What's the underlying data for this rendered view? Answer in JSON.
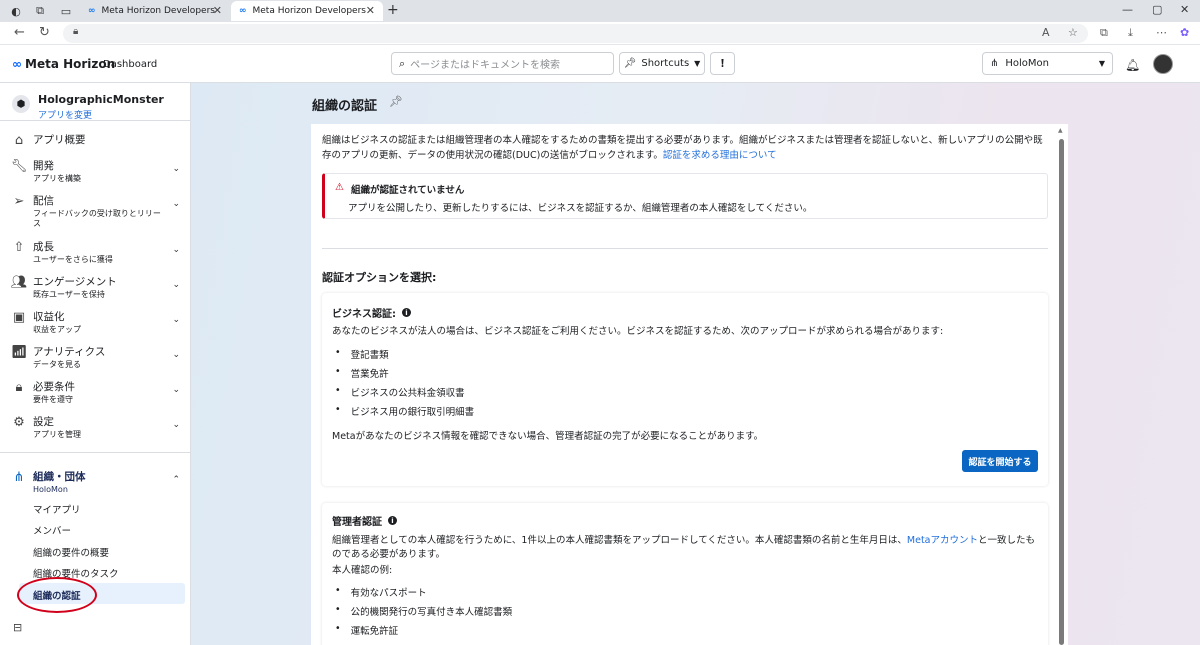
{
  "browser": {
    "tabs": [
      {
        "title": "Meta Horizon Developers",
        "close": "✕"
      },
      {
        "title": "Meta Horizon Developers",
        "close": "✕"
      }
    ],
    "new_tab": "+",
    "window_controls": [
      "—",
      "▢",
      "✕"
    ]
  },
  "header": {
    "logo": "Meta Horizon",
    "dashboard": "Dashboard",
    "search_placeholder": "ページまたはドキュメントを検索",
    "shortcuts_label": "Shortcuts",
    "org_selector": "HoloMon"
  },
  "sidebar": {
    "app_name": "HolographicMonster",
    "app_change": "アプリを変更",
    "items": [
      {
        "label": "アプリ概要",
        "sub": "",
        "icon": "home-icon"
      },
      {
        "label": "開発",
        "sub": "アプリを構築",
        "icon": "wrench-icon"
      },
      {
        "label": "配信",
        "sub": "フィードバックの受け取りとリリース",
        "icon": "send-icon"
      },
      {
        "label": "成長",
        "sub": "ユーザーをさらに獲得",
        "icon": "growth-icon"
      },
      {
        "label": "エンゲージメント",
        "sub": "既存ユーザーを保持",
        "icon": "people-icon"
      },
      {
        "label": "収益化",
        "sub": "収益をアップ",
        "icon": "money-icon"
      },
      {
        "label": "アナリティクス",
        "sub": "データを見る",
        "icon": "chart-icon"
      },
      {
        "label": "必要条件",
        "sub": "要件を遵守",
        "icon": "lock-icon"
      },
      {
        "label": "設定",
        "sub": "アプリを管理",
        "icon": "gear-icon"
      }
    ],
    "org": {
      "label": "組織・団体",
      "sub": "HoloMon"
    },
    "org_items": [
      "マイアプリ",
      "メンバー",
      "組織の要件の概要",
      "組織の要件のタスク",
      "組織の認証"
    ]
  },
  "main": {
    "title": "組織の認証",
    "intro": "組織はビジネスの認証または組織管理者の本人確認をするための書類を提出する必要があります。組織がビジネスまたは管理者を認証しないと、新しいアプリの公開や既存のアプリの更新、データの使用状況の確認(DUC)の送信がブロックされます。",
    "intro_link": "認証を求める理由について",
    "warning_title": "組織が認証されていません",
    "warning_body": "アプリを公開したり、更新したりするには、ビジネスを認証するか、組織管理者の本人確認をしてください。",
    "options_heading": "認証オプションを選択:",
    "business": {
      "title": "ビジネス認証:",
      "desc": "あなたのビジネスが法人の場合は、ビジネス認証をご利用ください。ビジネスを認証するため、次のアップロードが求められる場合があります:",
      "docs": [
        "登記書類",
        "営業免許",
        "ビジネスの公共料金領収書",
        "ビジネス用の銀行取引明細書"
      ],
      "note": "Metaがあなたのビジネス情報を確認できない場合、管理者認証の完了が必要になることがあります。",
      "button": "認証を開始する"
    },
    "admin": {
      "title": "管理者認証",
      "desc_a": "組織管理者としての本人確認を行うために、1件以上の本人確認書類をアップロードしてください。本人確認書類の名前と生年月日は、",
      "desc_link": "Metaアカウント",
      "desc_b": "と一致したものである必要があります。",
      "examples_label": "本人確認の例:",
      "docs": [
        "有効なパスポート",
        "公的機関発行の写真付き本人確認書類",
        "運転免許証"
      ]
    }
  }
}
